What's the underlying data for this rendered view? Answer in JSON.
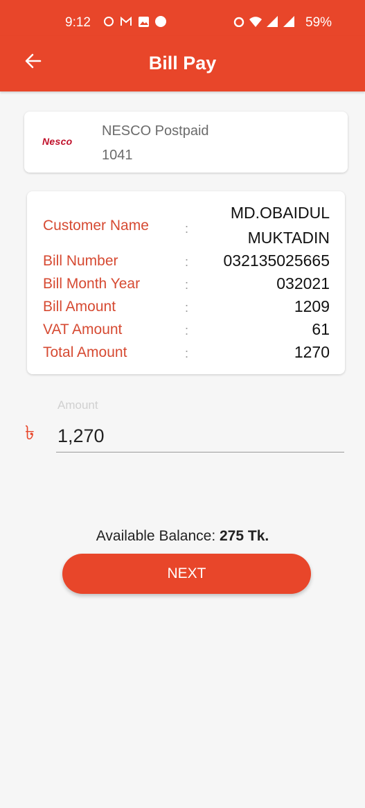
{
  "status_bar": {
    "time": "9:12",
    "battery": "59%",
    "left_icons": [
      "whatsapp-icon",
      "gmail-icon",
      "gallery-icon",
      "phone-icon"
    ],
    "right_icons": [
      "alarm-icon",
      "wifi-icon",
      "signal-icon",
      "signal-icon"
    ]
  },
  "app_bar": {
    "title": "Bill Pay",
    "back_icon": "arrow-left-icon",
    "color": "#e8462a"
  },
  "biller": {
    "logo_text": "Nesco",
    "name": "NESCO Postpaid",
    "code": "1041"
  },
  "details": {
    "separator": ":",
    "rows": [
      {
        "label": "Customer Name",
        "value_line1": "MD.OBAIDUL",
        "value_line2": "MUKTADIN"
      },
      {
        "label": "Bill Number",
        "value": "032135025665"
      },
      {
        "label": "Bill Month Year",
        "value": "032021"
      },
      {
        "label": "Bill Amount",
        "value": "1209"
      },
      {
        "label": "VAT Amount",
        "value": "61"
      },
      {
        "label": "Total Amount",
        "value": "1270"
      }
    ]
  },
  "amount_field": {
    "label": "Amount",
    "currency_symbol": "৳",
    "value": "1,270"
  },
  "balance": {
    "label": "Available Balance: ",
    "value": "275 Tk."
  },
  "next_button": {
    "label": "NEXT"
  },
  "colors": {
    "accent": "#e8462a",
    "label_red": "#d64a32",
    "background": "#f6f6f6"
  }
}
